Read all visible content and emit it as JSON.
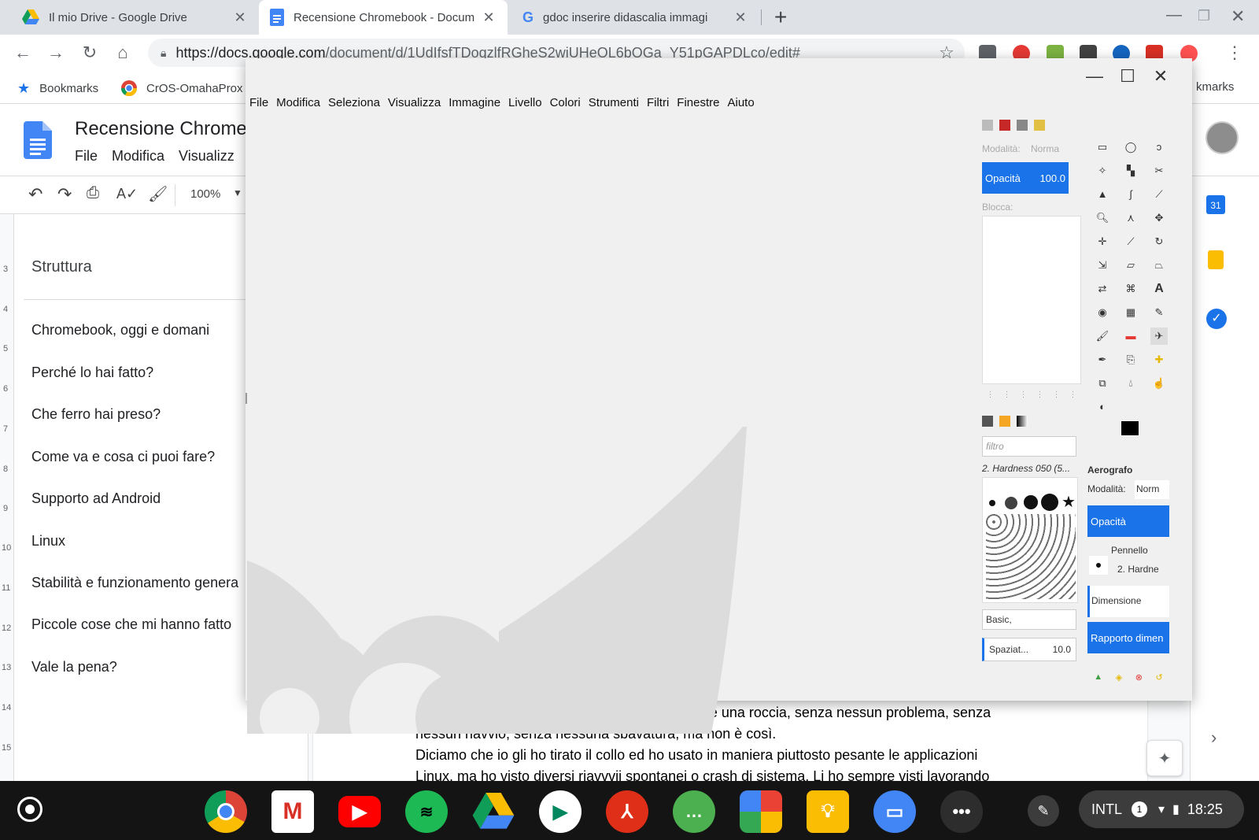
{
  "browser": {
    "tabs": [
      {
        "title": "Il mio Drive - Google Drive",
        "icon": "drive-icon",
        "active": false
      },
      {
        "title": "Recensione Chromebook - Docum",
        "icon": "docs-icon",
        "active": true
      },
      {
        "title": "gdoc inserire didascalia immagi",
        "icon": "google-icon",
        "active": false
      }
    ],
    "url_domain": "https://docs.google.com",
    "url_path": "/document/d/1UdIfsfTDoqzlfRGheS2wiUHeOL6bOGa_Y51pGAPDLco/edit#",
    "bookmarks": [
      {
        "label": "Bookmarks"
      },
      {
        "label": "CrOS-OmahaProx"
      }
    ],
    "bookmarks_right": "kmarks"
  },
  "docs": {
    "title": "Recensione Chrome",
    "menu": [
      "File",
      "Modifica",
      "Visualizz"
    ],
    "zoom": "100%",
    "outline_title": "Struttura",
    "outline": [
      "Chromebook, oggi e domani",
      "Perché lo hai fatto?",
      "Che ferro hai preso?",
      "Come va e cosa ci puoi fare?",
      "Supporto ad Android",
      "Linux",
      "Stabilità e funzionamento genera",
      "Piccole cose che mi hanno fatto",
      "Vale la pena?"
    ],
    "ruler_numbers": [
      "3",
      "4",
      "5",
      "6",
      "7",
      "8",
      "9",
      "10",
      "11",
      "12",
      "13",
      "14",
      "15"
    ],
    "paragraphs": [
      "Vorrei da fanboy, davvero vorrei poter dire che è una roccia, senza nessun problema, senza",
      "nessun riavvio, senza nessuna sbavatura, ma non è così.",
      "Diciamo che io gli ho tirato il collo ed ho usato in maniera piuttosto pesante le applicazioni",
      "Linux, ma ho visto diversi riavvvii spontanei o crash di sistema. Li ho sempre visti lavorando"
    ],
    "calendar_day": "31"
  },
  "gimp": {
    "menu": [
      "File",
      "Modifica",
      "Seleziona",
      "Visualizza",
      "Immagine",
      "Livello",
      "Colori",
      "Strumenti",
      "Filtri",
      "Finestre",
      "Aiuto"
    ],
    "layers": {
      "mode_label": "Modalità:",
      "mode_value": "Norma",
      "opacity_label": "Opacità",
      "opacity_value": "100.0",
      "lock_label": "Blocca:"
    },
    "brushes": {
      "filter_placeholder": "filtro",
      "brush_name": "2. Hardness 050 (5...",
      "tag": "Basic,",
      "spacing_label": "Spaziat...",
      "spacing_value": "10.0"
    },
    "tool_options": {
      "tool_name": "Aerografo",
      "mode_label": "Modalità:",
      "mode_value": "Norm",
      "opacity_label": "Opacità",
      "brush_label": "Pennello",
      "brush_value": "2. Hardne",
      "size_label": "Dimensione",
      "ratio_label": "Rapporto dimen"
    }
  },
  "shelf": {
    "apps": [
      "chrome",
      "gmail",
      "youtube",
      "spotify",
      "drive",
      "play-store",
      "acrobat",
      "chat",
      "photos",
      "keep",
      "files",
      "more"
    ],
    "ime": "INTL",
    "notifications": "1",
    "time": "18:25"
  },
  "colors": {
    "accent": "#1a73e8",
    "tabstrip": "#dee1e6",
    "shelf": "#141414",
    "gimp_bg": "#f0f0f0",
    "wilber": "#dcdcdc"
  }
}
